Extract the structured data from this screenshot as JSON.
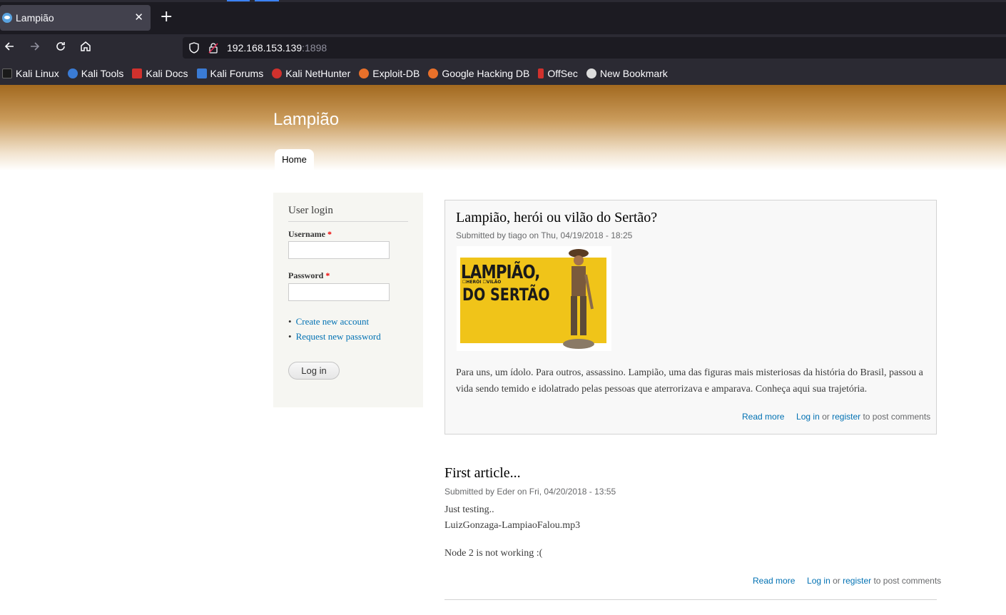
{
  "browser": {
    "tab": {
      "title": "Lampião",
      "close": "✕"
    },
    "new_tab": "+",
    "url": {
      "host": "192.168.153.139",
      "port": ":1898"
    },
    "bookmarks": [
      {
        "label": "Kali Linux",
        "icon": "kali-dragon-icon",
        "color": "#222222"
      },
      {
        "label": "Kali Tools",
        "icon": "kali-tools-icon",
        "color": "#3a7bd5"
      },
      {
        "label": "Kali Docs",
        "icon": "kali-docs-icon",
        "color": "#d0312d"
      },
      {
        "label": "Kali Forums",
        "icon": "kali-forums-icon",
        "color": "#3a7bd5"
      },
      {
        "label": "Kali NetHunter",
        "icon": "kali-nethunter-icon",
        "color": "#d0312d"
      },
      {
        "label": "Exploit-DB",
        "icon": "exploit-db-icon",
        "color": "#e8702a"
      },
      {
        "label": "Google Hacking DB",
        "icon": "ghdb-icon",
        "color": "#e8702a"
      },
      {
        "label": "OffSec",
        "icon": "offsec-icon",
        "color": "#d0312d"
      },
      {
        "label": "New Bookmark",
        "icon": "bookmark-icon",
        "color": "#dddddd"
      }
    ]
  },
  "site": {
    "name": "Lampião",
    "nav_home": "Home"
  },
  "login": {
    "title": "User login",
    "username_label": "Username",
    "password_label": "Password",
    "required_mark": "*",
    "links": [
      "Create new account",
      "Request new password"
    ],
    "button": "Log in"
  },
  "nodes": [
    {
      "title": "Lampião, herói ou vilão do Sertão?",
      "meta": "Submitted by tiago on Thu, 04/19/2018 - 18:25",
      "image_text_1": "LAMPIÃO,",
      "image_text_2": "☐HERÓI  ☐VILÃO",
      "image_text_3": "DO SERTÃO",
      "body_1": "Para uns, um ídolo. Para outros, assassino. Lampião, uma das figuras mais misteriosas da história do Brasil, passou a",
      "body_2": "vida sendo temido e idolatrado pelas pessoas que aterrorizava e amparava. Conheça aqui sua trajetória.",
      "read_more": "Read more",
      "login": "Log in",
      "or": "or",
      "register": "register",
      "to_post": "to post comments"
    },
    {
      "title": "First article...",
      "meta": "Submitted by Eder on Fri, 04/20/2018 - 13:55",
      "body_1": "Just testing..",
      "body_2": "LuizGonzaga-LampiaoFalou.mp3",
      "body_3": "Node 2 is not working :(",
      "read_more": "Read more",
      "login": "Log in",
      "or": "or",
      "register": "register",
      "to_post": "to post comments"
    }
  ]
}
